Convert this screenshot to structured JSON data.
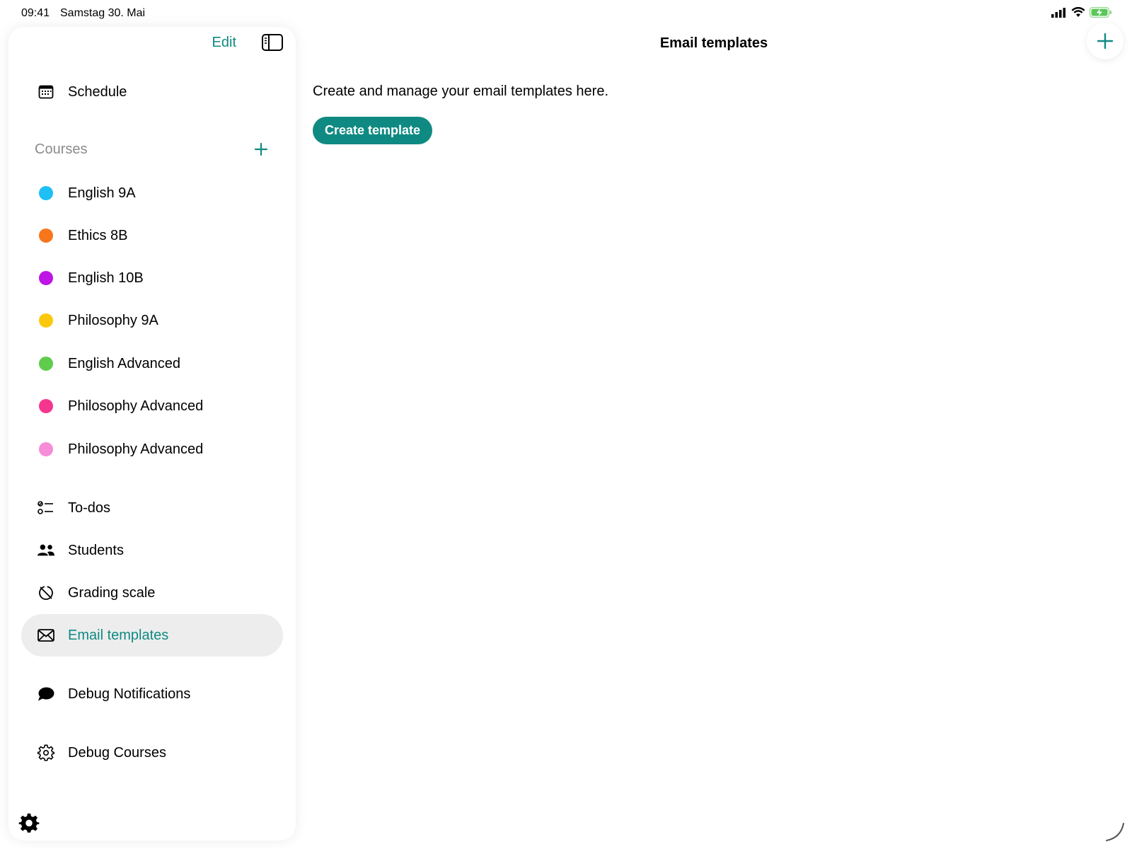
{
  "status_bar": {
    "time": "09:41",
    "date": "Samstag 30. Mai",
    "icons": [
      "signal-icon",
      "wifi-icon",
      "battery-charging-icon"
    ]
  },
  "sidebar": {
    "edit_label": "Edit",
    "toggle_icon": "sidebar-toggle-icon",
    "schedule": {
      "label": "Schedule",
      "icon": "calendar-icon"
    },
    "courses_section": {
      "title": "Courses",
      "add_icon": "plus-icon",
      "items": [
        {
          "label": "English 9A",
          "color": "#1dbff5"
        },
        {
          "label": "Ethics 8B",
          "color": "#f7761c"
        },
        {
          "label": "English 10B",
          "color": "#be14e6"
        },
        {
          "label": "Philosophy 9A",
          "color": "#fcc80d"
        },
        {
          "label": "English Advanced",
          "color": "#5fcc4c"
        },
        {
          "label": "Philosophy Advanced",
          "color": "#f5368f"
        },
        {
          "label": "Philosophy Advanced",
          "color": "#f78cd8"
        }
      ]
    },
    "tools": [
      {
        "label": "To-dos",
        "icon": "checklist-icon"
      },
      {
        "label": "Students",
        "icon": "people-icon"
      },
      {
        "label": "Grading scale",
        "icon": "grading-scale-icon"
      },
      {
        "label": "Email templates",
        "icon": "envelope-icon",
        "active": true
      }
    ],
    "debug_notifications": {
      "label": "Debug Notifications",
      "icon": "chat-bubble-icon"
    },
    "debug_courses": {
      "label": "Debug Courses",
      "icon": "gear-outline-icon"
    },
    "settings_icon": "gear-icon"
  },
  "main": {
    "title": "Email templates",
    "add_icon": "plus-icon",
    "intro": "Create and manage your email templates here.",
    "create_button_label": "Create template"
  },
  "colors": {
    "accent": "#0f8a82",
    "active_bg": "#ededed",
    "section_title": "#8a8a8a"
  }
}
